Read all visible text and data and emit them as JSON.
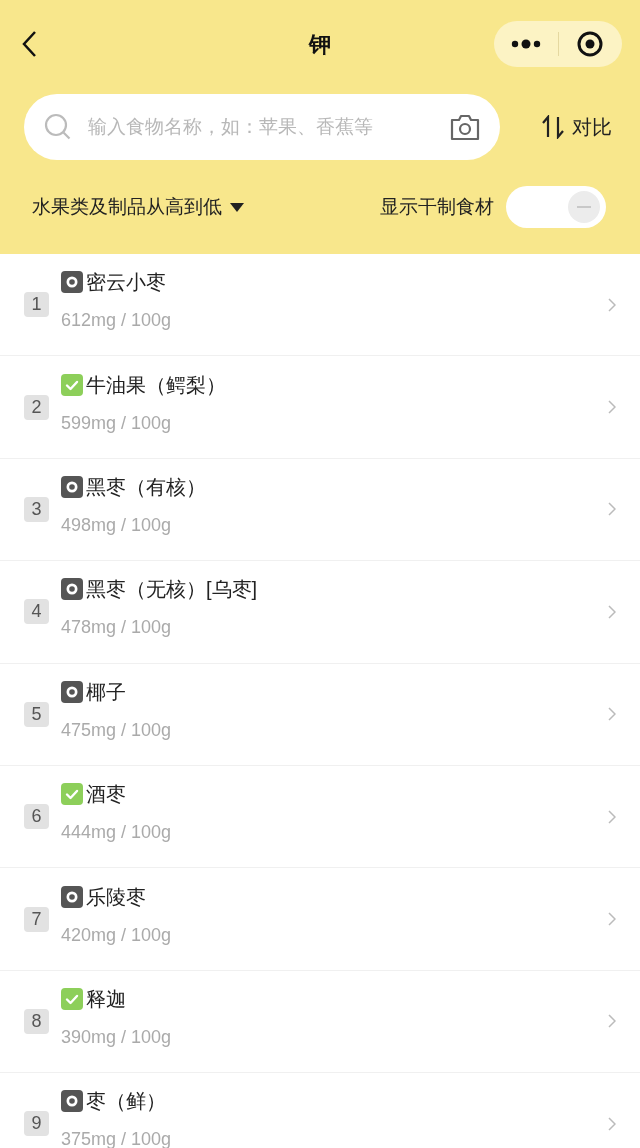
{
  "title": "钾",
  "search": {
    "placeholder": "输入食物名称，如：苹果、香蕉等"
  },
  "compare_button": "对比",
  "sort_dropdown": "水果类及制品从高到低",
  "dried_toggle": {
    "label": "显示干制食材",
    "on": true
  },
  "items": [
    {
      "rank": "1",
      "kind": "dot",
      "name": "密云小枣",
      "amount": "612mg / 100g"
    },
    {
      "rank": "2",
      "kind": "check",
      "name": "牛油果（鳄梨）",
      "amount": "599mg / 100g"
    },
    {
      "rank": "3",
      "kind": "dot",
      "name": "黑枣（有核）",
      "amount": "498mg / 100g"
    },
    {
      "rank": "4",
      "kind": "dot",
      "name": "黑枣（无核）[乌枣]",
      "amount": "478mg / 100g"
    },
    {
      "rank": "5",
      "kind": "dot",
      "name": "椰子",
      "amount": "475mg / 100g"
    },
    {
      "rank": "6",
      "kind": "check",
      "name": "酒枣",
      "amount": "444mg / 100g"
    },
    {
      "rank": "7",
      "kind": "dot",
      "name": "乐陵枣",
      "amount": "420mg / 100g"
    },
    {
      "rank": "8",
      "kind": "check",
      "name": "释迦",
      "amount": "390mg / 100g"
    },
    {
      "rank": "9",
      "kind": "dot",
      "name": "枣（鲜）",
      "amount": "375mg / 100g"
    }
  ]
}
